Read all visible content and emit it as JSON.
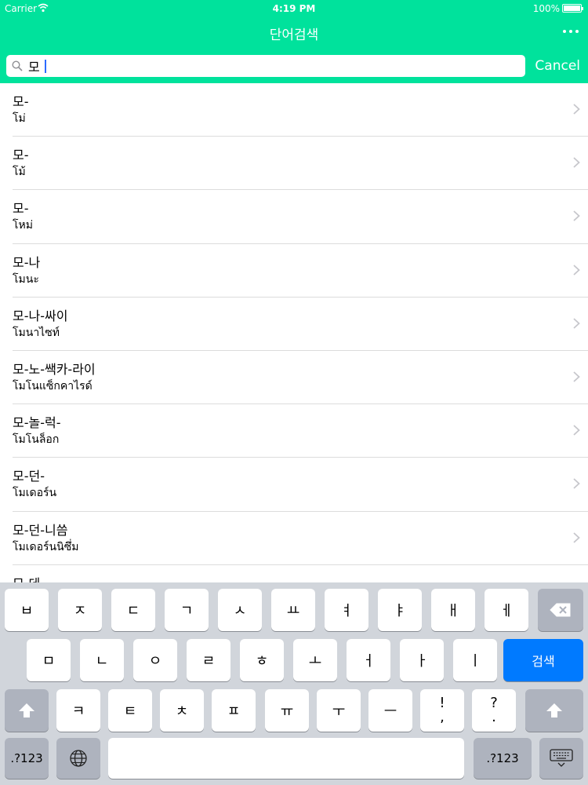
{
  "status": {
    "carrier": "Carrier",
    "time": "4:19 PM",
    "battery": "100%"
  },
  "nav": {
    "title": "단어검색"
  },
  "search": {
    "value": "모",
    "cancel_label": "Cancel"
  },
  "results": [
    {
      "korean": "모-",
      "thai": "โม่"
    },
    {
      "korean": "모-",
      "thai": "โม้"
    },
    {
      "korean": "모-",
      "thai": "โหม่"
    },
    {
      "korean": "모-나",
      "thai": "โมนะ"
    },
    {
      "korean": "모-나-싸이",
      "thai": "โมนาไซท์"
    },
    {
      "korean": "모-노-쌕카-라이",
      "thai": "โมโนแซ็กคาไรด์"
    },
    {
      "korean": "모-놀-럭-",
      "thai": "โมโนล็อก"
    },
    {
      "korean": "모-던-",
      "thai": "โมเดอร์น"
    },
    {
      "korean": "모-던-니씀",
      "thai": "โมเดอร์นนิซึ่ม"
    },
    {
      "korean": "모-데",
      "thai": ""
    }
  ],
  "keyboard": {
    "row1": [
      "ㅂ",
      "ㅈ",
      "ㄷ",
      "ㄱ",
      "ㅅ",
      "ㅛ",
      "ㅕ",
      "ㅑ",
      "ㅐ",
      "ㅔ"
    ],
    "row2": [
      "ㅁ",
      "ㄴ",
      "ㅇ",
      "ㄹ",
      "ㅎ",
      "ㅗ",
      "ㅓ",
      "ㅏ",
      "ㅣ"
    ],
    "row3": [
      "ㅋ",
      "ㅌ",
      "ㅊ",
      "ㅍ",
      "ㅠ",
      "ㅜ",
      "ㅡ",
      "!\n,",
      "?\n."
    ],
    "search_label": "검색",
    "numbers_label": ".?123"
  }
}
